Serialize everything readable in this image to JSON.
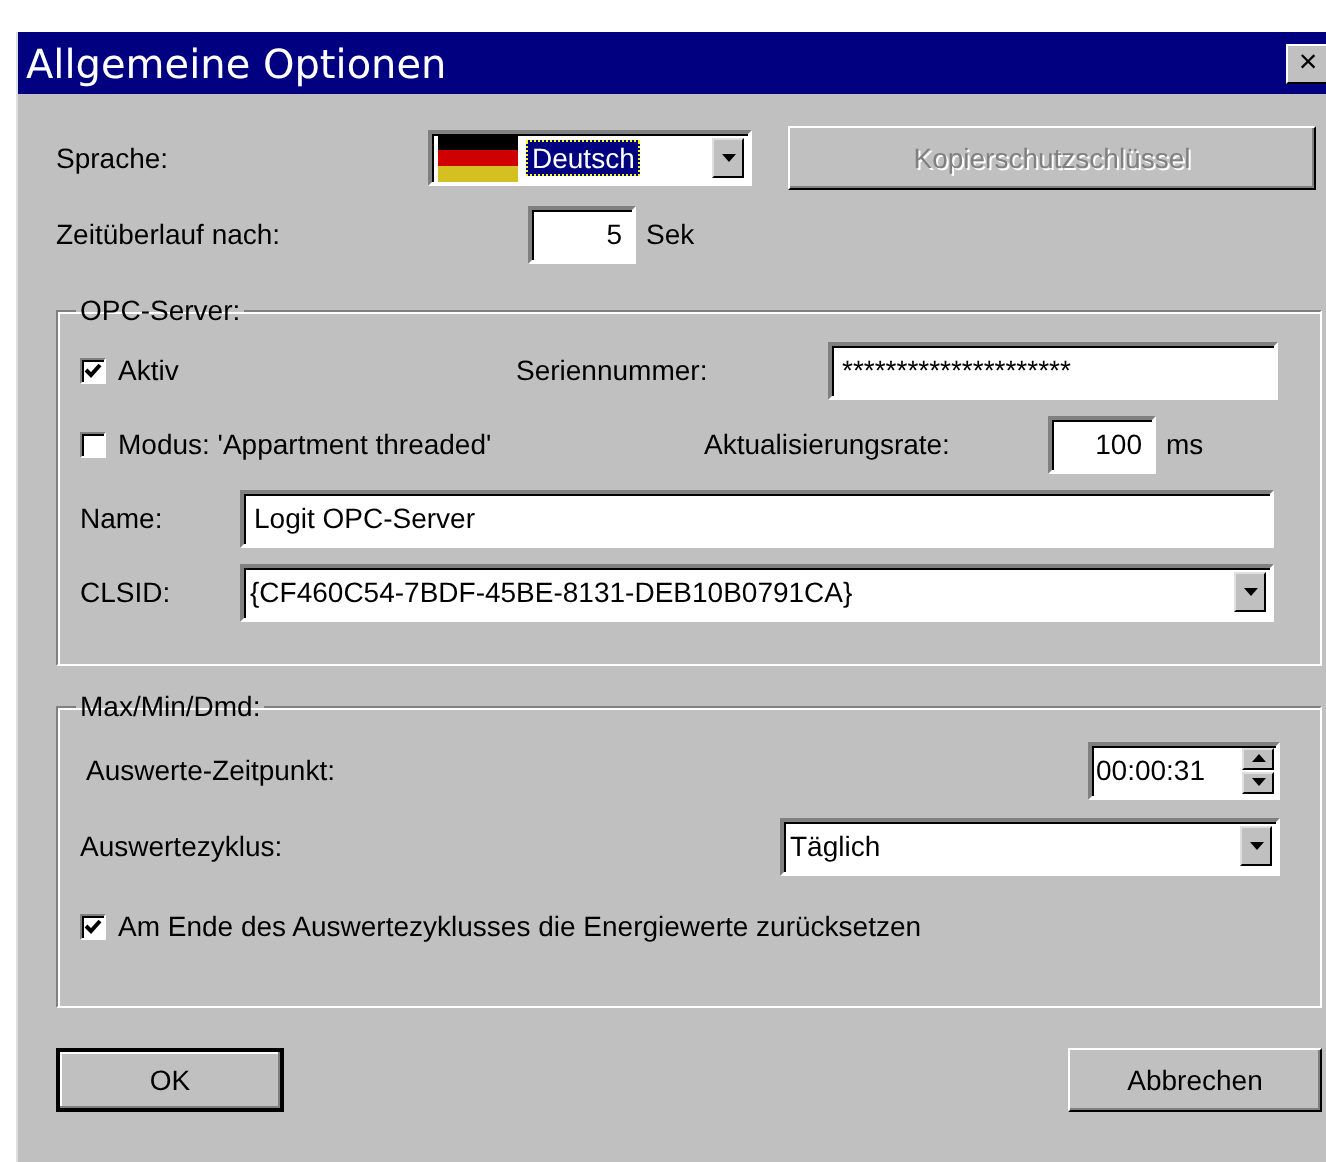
{
  "window": {
    "title": "Allgemeine Optionen",
    "close": "×"
  },
  "language": {
    "label": "Sprache:",
    "value": "Deutsch",
    "selected": true
  },
  "copy_protection_button": {
    "label": "Kopierschutzschlüssel",
    "disabled": true
  },
  "timeout": {
    "label": "Zeitüberlauf nach:",
    "value": "5",
    "unit": "Sek"
  },
  "opc_server": {
    "title": "OPC-Server:",
    "active": {
      "label": "Aktiv",
      "checked": true
    },
    "serial": {
      "label": "Seriennummer:",
      "value": "*********************"
    },
    "mode": {
      "label": "Modus: 'Appartment threaded'",
      "checked": false
    },
    "update_rate": {
      "label": "Aktualisierungsrate:",
      "value": "100",
      "unit": "ms"
    },
    "name": {
      "label": "Name:",
      "value": "Logit OPC-Server"
    },
    "clsid": {
      "label": "CLSID:",
      "value": "{CF460C54-7BDF-45BE-8131-DEB10B0791CA}"
    }
  },
  "max_min_dmd": {
    "title": "Max/Min/Dmd:",
    "eval_time": {
      "label": "Auswerte-Zeitpunkt:",
      "value": "00:00:31"
    },
    "eval_cycle": {
      "label": "Auswertezyklus:",
      "value": "Täglich"
    },
    "reset": {
      "label": "Am Ende des Auswertezyklusses die Energiewerte zurücksetzen",
      "checked": true
    }
  },
  "buttons": [
    {
      "label": "OK",
      "default": true
    },
    {
      "label": "Abbrechen",
      "default": false
    }
  ]
}
